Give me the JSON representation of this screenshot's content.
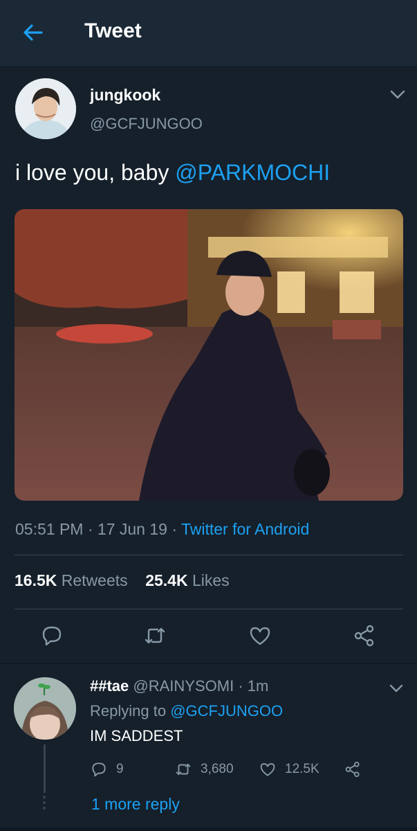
{
  "header": {
    "title": "Tweet",
    "back_icon": "arrow-left-icon"
  },
  "tweet": {
    "author_name": "jungkook",
    "author_handle": "@GCFJUNGOO",
    "text_plain": "i love you, baby ",
    "mention": "@PARKMOCHI",
    "time": "05:51 PM",
    "sep1": " · ",
    "date": "17 Jun 19",
    "sep2": " · ",
    "source": "Twitter for Android",
    "retweets_count": "16.5K",
    "retweets_label": "Retweets",
    "likes_count": "25.4K",
    "likes_label": "Likes"
  },
  "actions": [
    "reply-icon",
    "retweet-icon",
    "like-icon",
    "share-icon"
  ],
  "reply": {
    "name": "##tae",
    "handle": "@RAINYSOMI",
    "sep": " · ",
    "time": "1m",
    "replying_label": "Replying to ",
    "replying_handle": "@GCFJUNGOO",
    "text": "IM SADDEST",
    "reply_count": "9",
    "retweet_count": "3,680",
    "like_count": "12.5K",
    "more_replies": "1 more reply"
  },
  "colors": {
    "background": "#15202b",
    "header": "#1b2836",
    "accent": "#1da1f2",
    "secondary_text": "#8899a6",
    "divider": "#38444d"
  }
}
